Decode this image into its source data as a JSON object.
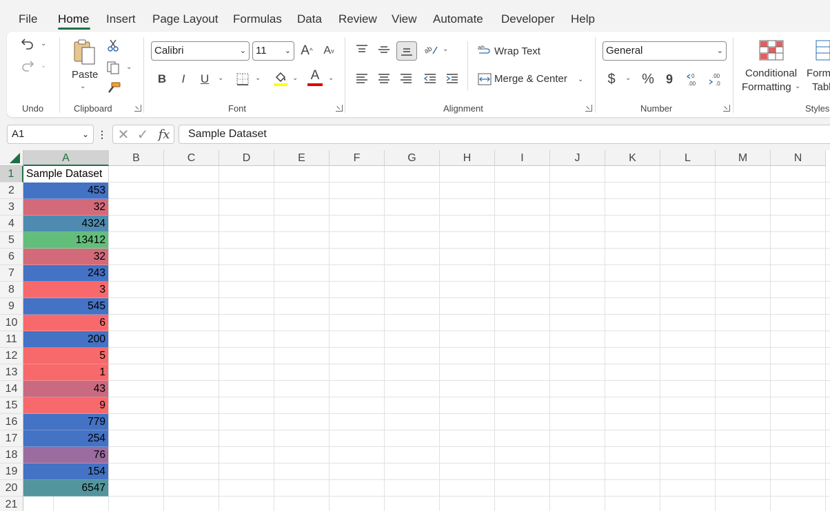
{
  "tabs": [
    "File",
    "Home",
    "Insert",
    "Page Layout",
    "Formulas",
    "Data",
    "Review",
    "View",
    "Automate",
    "Developer",
    "Help"
  ],
  "ribbon": {
    "undo": {
      "group": "Undo"
    },
    "clipboard": {
      "group": "Clipboard",
      "paste": "Paste"
    },
    "font": {
      "group": "Font",
      "name": "Calibri",
      "size": "11",
      "bold": "B",
      "italic": "I",
      "underline": "U",
      "grow": "A",
      "shrink": "A",
      "color_letter": "A",
      "fill_color": "#ffff00",
      "font_color": "#e00000"
    },
    "alignment": {
      "group": "Alignment",
      "wrap": "Wrap Text",
      "merge": "Merge & Center"
    },
    "number": {
      "group": "Number",
      "format": "General",
      "currency": "$",
      "percent": "%",
      "comma": "9"
    },
    "styles": {
      "group": "Styles",
      "conditional": "Conditional",
      "conditional2": "Formatting",
      "format_table": "Form",
      "format_table2": "Tabl"
    }
  },
  "formula_bar": {
    "name_box": "A1",
    "fx": "fx",
    "content": "Sample Dataset"
  },
  "columns": [
    "A",
    "B",
    "C",
    "D",
    "E",
    "F",
    "G",
    "H",
    "I",
    "J",
    "K",
    "L",
    "M",
    "N"
  ],
  "rows": [
    "1",
    "2",
    "3",
    "4",
    "5",
    "6",
    "7",
    "8",
    "9",
    "10",
    "11",
    "12",
    "13",
    "14",
    "15",
    "16",
    "17",
    "18",
    "19",
    "20",
    "21"
  ],
  "sheet": {
    "header": "Sample Dataset",
    "values": [
      "453",
      "32",
      "4324",
      "13412",
      "32",
      "243",
      "3",
      "545",
      "6",
      "200",
      "5",
      "1",
      "43",
      "9",
      "779",
      "254",
      "76",
      "154",
      "6547"
    ],
    "colors": [
      "#4472c4",
      "#d36a7a",
      "#4f8bb0",
      "#63be7b",
      "#d36a7a",
      "#4472c4",
      "#f8696b",
      "#4472c4",
      "#f8696b",
      "#4472c4",
      "#f8696b",
      "#f8696b",
      "#c96a80",
      "#f8696b",
      "#4472c4",
      "#4472c4",
      "#9a6c9f",
      "#4472c4",
      "#53959d"
    ]
  },
  "accent": "#1e7145"
}
